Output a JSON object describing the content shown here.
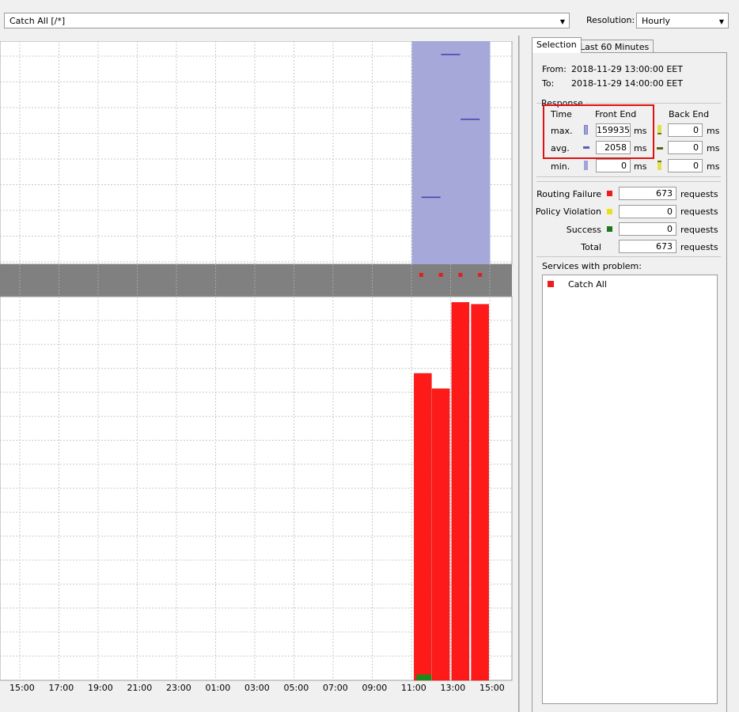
{
  "toolbar": {
    "service_combo_value": "Catch All [/*]",
    "resolution_label": "Resolution:",
    "resolution_value": "Hourly"
  },
  "chart_data": [
    {
      "type": "bar",
      "title": "",
      "xlabel": "",
      "ylabel": "",
      "x_ticks": [
        "15:00",
        "17:00",
        "19:00",
        "21:00",
        "23:00",
        "01:00",
        "03:00",
        "05:00",
        "07:00",
        "09:00",
        "11:00",
        "13:00",
        "15:00"
      ],
      "highlight_range": [
        "12:00",
        "15:00"
      ],
      "response_markers": [
        {
          "x": "13:00",
          "y_fraction": 0.94
        },
        {
          "x": "14:00",
          "y_fraction": 0.65
        },
        {
          "x": "12:00",
          "y_fraction": 0.3
        }
      ],
      "colors": {
        "highlight": "#a5a8d8",
        "marker": "#4040b0"
      }
    },
    {
      "type": "bar",
      "title": "",
      "x_ticks": [
        "15:00",
        "17:00",
        "19:00",
        "21:00",
        "23:00",
        "01:00",
        "03:00",
        "05:00",
        "07:00",
        "09:00",
        "11:00",
        "13:00",
        "15:00"
      ],
      "status_strip": {
        "x": [
          "12:00",
          "13:00",
          "14:00",
          "15:00"
        ],
        "color": "#e02020"
      },
      "bars": [
        {
          "x": "12:00",
          "failure_fraction": 0.8,
          "success_fraction": 0.015
        },
        {
          "x": "13:00",
          "failure_fraction": 0.76,
          "success_fraction": 0
        },
        {
          "x": "14:00",
          "failure_fraction": 0.985,
          "success_fraction": 0
        },
        {
          "x": "15:00",
          "failure_fraction": 0.98,
          "success_fraction": 0
        }
      ],
      "colors": {
        "failure": "#ff1a1a",
        "success": "#1a8a1a"
      }
    }
  ],
  "panel": {
    "tabs": [
      {
        "label": "Selection",
        "active": true
      },
      {
        "label": "Last 60 Minutes",
        "active": false
      }
    ],
    "from_label": "From:",
    "from_value": "2018-11-29 13:00:00 EET",
    "to_label": "To:",
    "to_value": "2018-11-29 14:00:00 EET",
    "response_group_label": "Response",
    "time_header": "Time",
    "front_end_header": "Front End",
    "back_end_header": "Back End",
    "unit_ms": "ms",
    "unit_requests": "requests",
    "rows": [
      {
        "label": "max.",
        "front": "159935",
        "back": "0"
      },
      {
        "label": "avg.",
        "front": "2058",
        "back": "0"
      },
      {
        "label": "min.",
        "front": "0",
        "back": "0"
      }
    ],
    "counts": [
      {
        "label": "Routing Failure",
        "value": "673",
        "color": "#ee1c1c"
      },
      {
        "label": "Policy Violation",
        "value": "0",
        "color": "#e8e020"
      },
      {
        "label": "Success",
        "value": "0",
        "color": "#1a7a1a"
      },
      {
        "label": "Total",
        "value": "673"
      }
    ],
    "services_label": "Services with problem:",
    "services": [
      {
        "name": "Catch All",
        "color": "#ee1c1c"
      }
    ]
  }
}
